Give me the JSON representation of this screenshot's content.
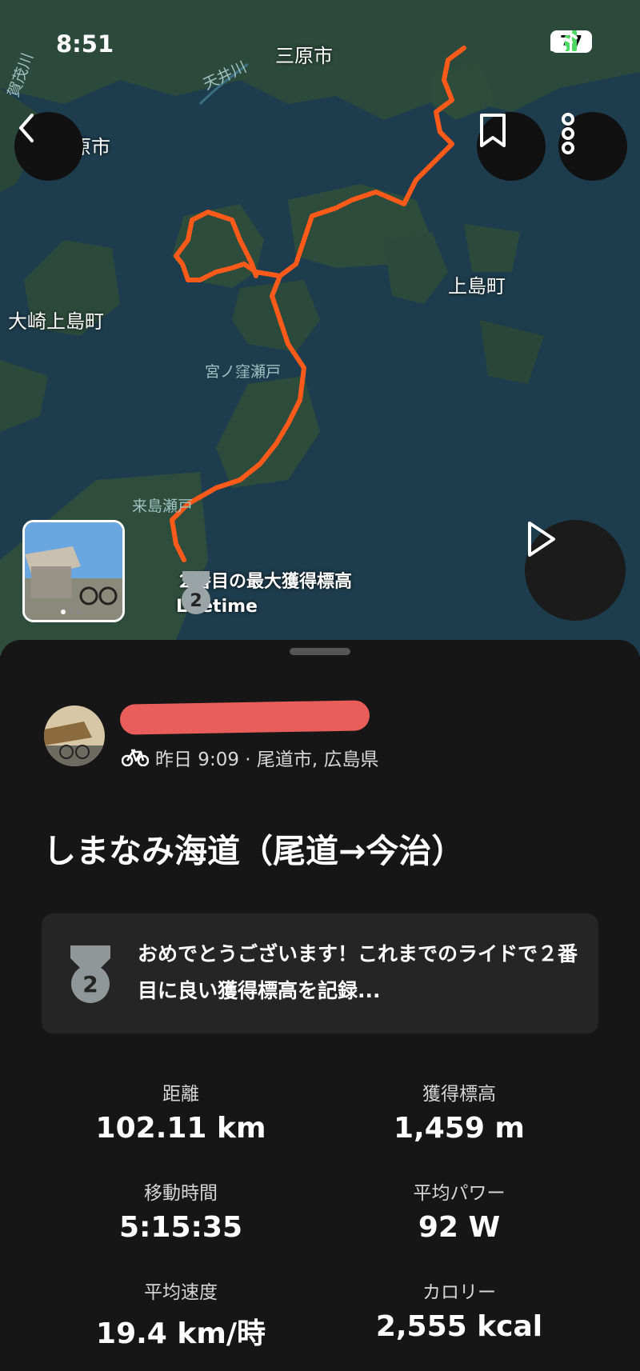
{
  "status_bar": {
    "time": "8:51",
    "battery": "77"
  },
  "map": {
    "labels": {
      "mihara": "三原市",
      "tenjingawa": "天井川",
      "top_left_city": "原市",
      "left_river": "賀茂川",
      "kamijima": "上島町",
      "osakikamijima": "大崎上島町",
      "miyanokubo": "宮ノ窪瀬戸",
      "kurushima": "来島瀬戸"
    },
    "achievement": {
      "line1": "２番目の最大獲得標高",
      "line2": "Lifetime",
      "rank": "2"
    }
  },
  "activity": {
    "meta": "昨日 9:09 · 尾道市, 広島県",
    "title": "しまなみ海道（尾道→今治）",
    "achievement_message": "おめでとうございます！これまでのライドで２番目に良い獲得標高を記録...",
    "achievement_rank": "2",
    "stats": [
      {
        "label": "距離",
        "value": "102.11 km"
      },
      {
        "label": "獲得標高",
        "value": "1,459 m"
      },
      {
        "label": "移動時間",
        "value": "5:15:35"
      },
      {
        "label": "平均パワー",
        "value": "92 W"
      },
      {
        "label": "平均速度",
        "value": "19.4 km/時"
      },
      {
        "label": "カロリー",
        "value": "2,555 kcal"
      }
    ]
  },
  "colors": {
    "route": "#ff5a1a",
    "sea": "#1d3d4e",
    "land": "#2c4a3c",
    "card": "#252525",
    "redaction": "#e95e5a"
  },
  "icons": [
    "back-icon",
    "bookmark-icon",
    "more-icon",
    "play-icon",
    "medal-icon",
    "bike-icon",
    "signal-icon",
    "wifi-icon"
  ]
}
